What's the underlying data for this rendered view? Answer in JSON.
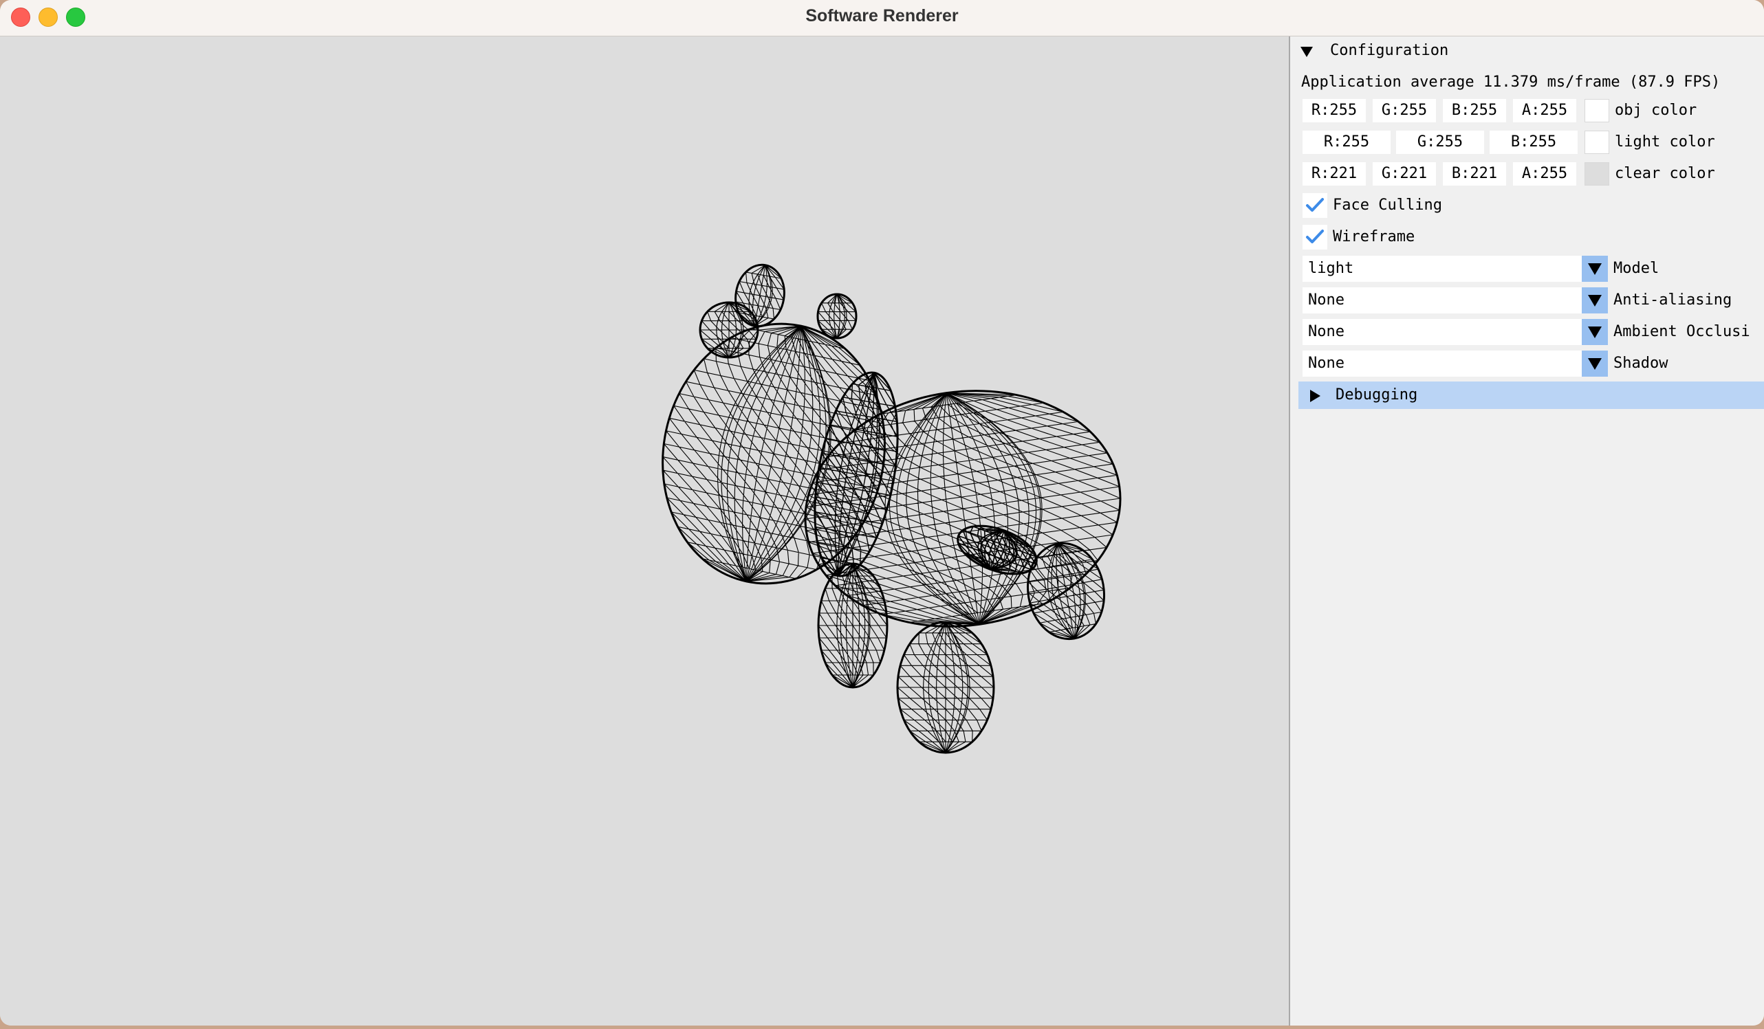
{
  "window": {
    "title": "Software Renderer"
  },
  "panel": {
    "configuration_header": "Configuration",
    "perf_text": "Application average 11.379 ms/frame (87.9 FPS)",
    "obj_color": {
      "r": "R:255",
      "g": "G:255",
      "b": "B:255",
      "a": "A:255",
      "label": "obj color",
      "swatch": "#ffffff"
    },
    "light_color": {
      "r": "R:255",
      "g": "G:255",
      "b": "B:255",
      "label": "light color",
      "swatch": "#ffffff"
    },
    "clear_color": {
      "r": "R:221",
      "g": "G:221",
      "b": "B:221",
      "a": "A:255",
      "label": "clear color",
      "swatch": "#dddddd"
    },
    "face_culling": {
      "label": "Face Culling",
      "checked": true
    },
    "wireframe": {
      "label": "Wireframe",
      "checked": true
    },
    "model": {
      "value": "light",
      "label": "Model"
    },
    "anti_aliasing": {
      "value": "None",
      "label": "Anti-aliasing"
    },
    "ambient_occlusion": {
      "value": "None",
      "label": "Ambient Occlusi"
    },
    "shadow": {
      "value": "None",
      "label": "Shadow"
    },
    "debugging_header": "Debugging"
  },
  "colors": {
    "viewport_bg": "#dddddd",
    "accent": "#97bff0",
    "check": "#3d8be8",
    "header_highlight": "#bad4f5"
  },
  "icons": [
    "close-icon",
    "minimize-icon",
    "maximize-icon",
    "triangle-down-icon",
    "triangle-right-icon",
    "checkmark-icon",
    "dropdown-arrow-icon"
  ]
}
